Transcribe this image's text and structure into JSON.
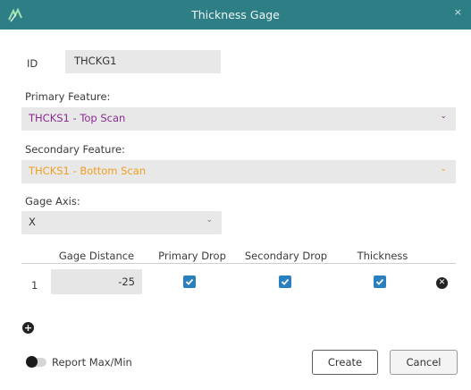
{
  "window": {
    "title": "Thickness Gage",
    "close_glyph": "×",
    "accent": "#2e7e86"
  },
  "id_field": {
    "label": "ID",
    "value": "THCKG1"
  },
  "primary_feature": {
    "label": "Primary Feature:",
    "value": "THCKS1 - Top Scan",
    "color": "#8a2b8f"
  },
  "secondary_feature": {
    "label": "Secondary Feature:",
    "value": "THCKS1 - Bottom Scan",
    "color": "#f0a020"
  },
  "gage_axis": {
    "label": "Gage Axis:",
    "value": "X"
  },
  "table": {
    "headers": [
      "Gage Distance",
      "Primary Drop",
      "Secondary Drop",
      "Thickness"
    ],
    "rows": [
      {
        "index": "1",
        "gage_distance": "-25",
        "primary_drop": true,
        "secondary_drop": true,
        "thickness": true
      }
    ]
  },
  "report_toggle": {
    "label": "Report Max/Min",
    "on": false
  },
  "buttons": {
    "create": "Create",
    "cancel": "Cancel"
  },
  "icons": {
    "logo": "app-logo-icon",
    "remove_row": "remove-row-icon",
    "add_row": "add-row-icon",
    "check": "check-icon",
    "chevron": "chevron-down-icon"
  }
}
